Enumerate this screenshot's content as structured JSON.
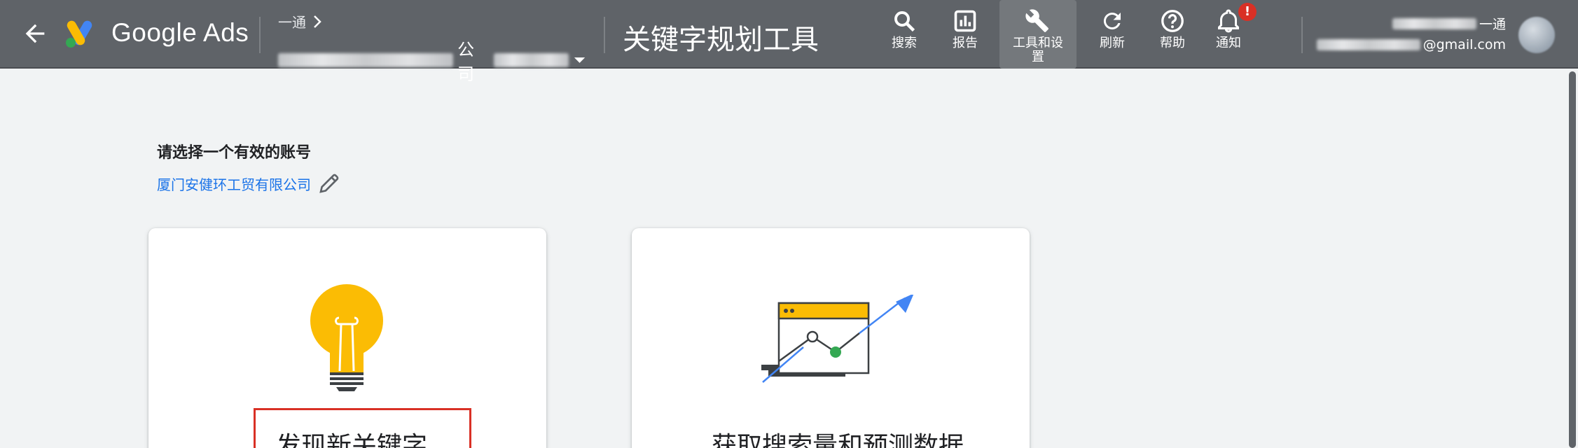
{
  "header": {
    "brand": "Google Ads",
    "account_top_label": "一通",
    "account_name_suffix": "公司",
    "page_title": "关键字规划工具",
    "nav": [
      {
        "label": "搜索",
        "icon": "search-icon"
      },
      {
        "label": "报告",
        "icon": "report-icon"
      },
      {
        "label": "工具和设\n置",
        "icon": "wrench-icon"
      },
      {
        "label": "刷新",
        "icon": "refresh-icon"
      },
      {
        "label": "帮助",
        "icon": "help-icon"
      },
      {
        "label": "通知",
        "icon": "bell-icon"
      }
    ],
    "notification_badge": "!",
    "user_name_suffix": "一通",
    "user_email_suffix": "@gmail.com"
  },
  "main": {
    "section_title": "请选择一个有效的账号",
    "account_link": "厦门安健环工贸有限公司",
    "cards": [
      {
        "title": "发现新关键字",
        "icon": "lightbulb-icon"
      },
      {
        "title": "获取搜索量和预测数据",
        "icon": "chart-trend-icon"
      }
    ]
  },
  "colors": {
    "topbar": "#5f6368",
    "link": "#1a73e8",
    "highlight": "#d93025",
    "bulb": "#fbbc04",
    "trend": "#4285f4",
    "point": "#34a853"
  }
}
